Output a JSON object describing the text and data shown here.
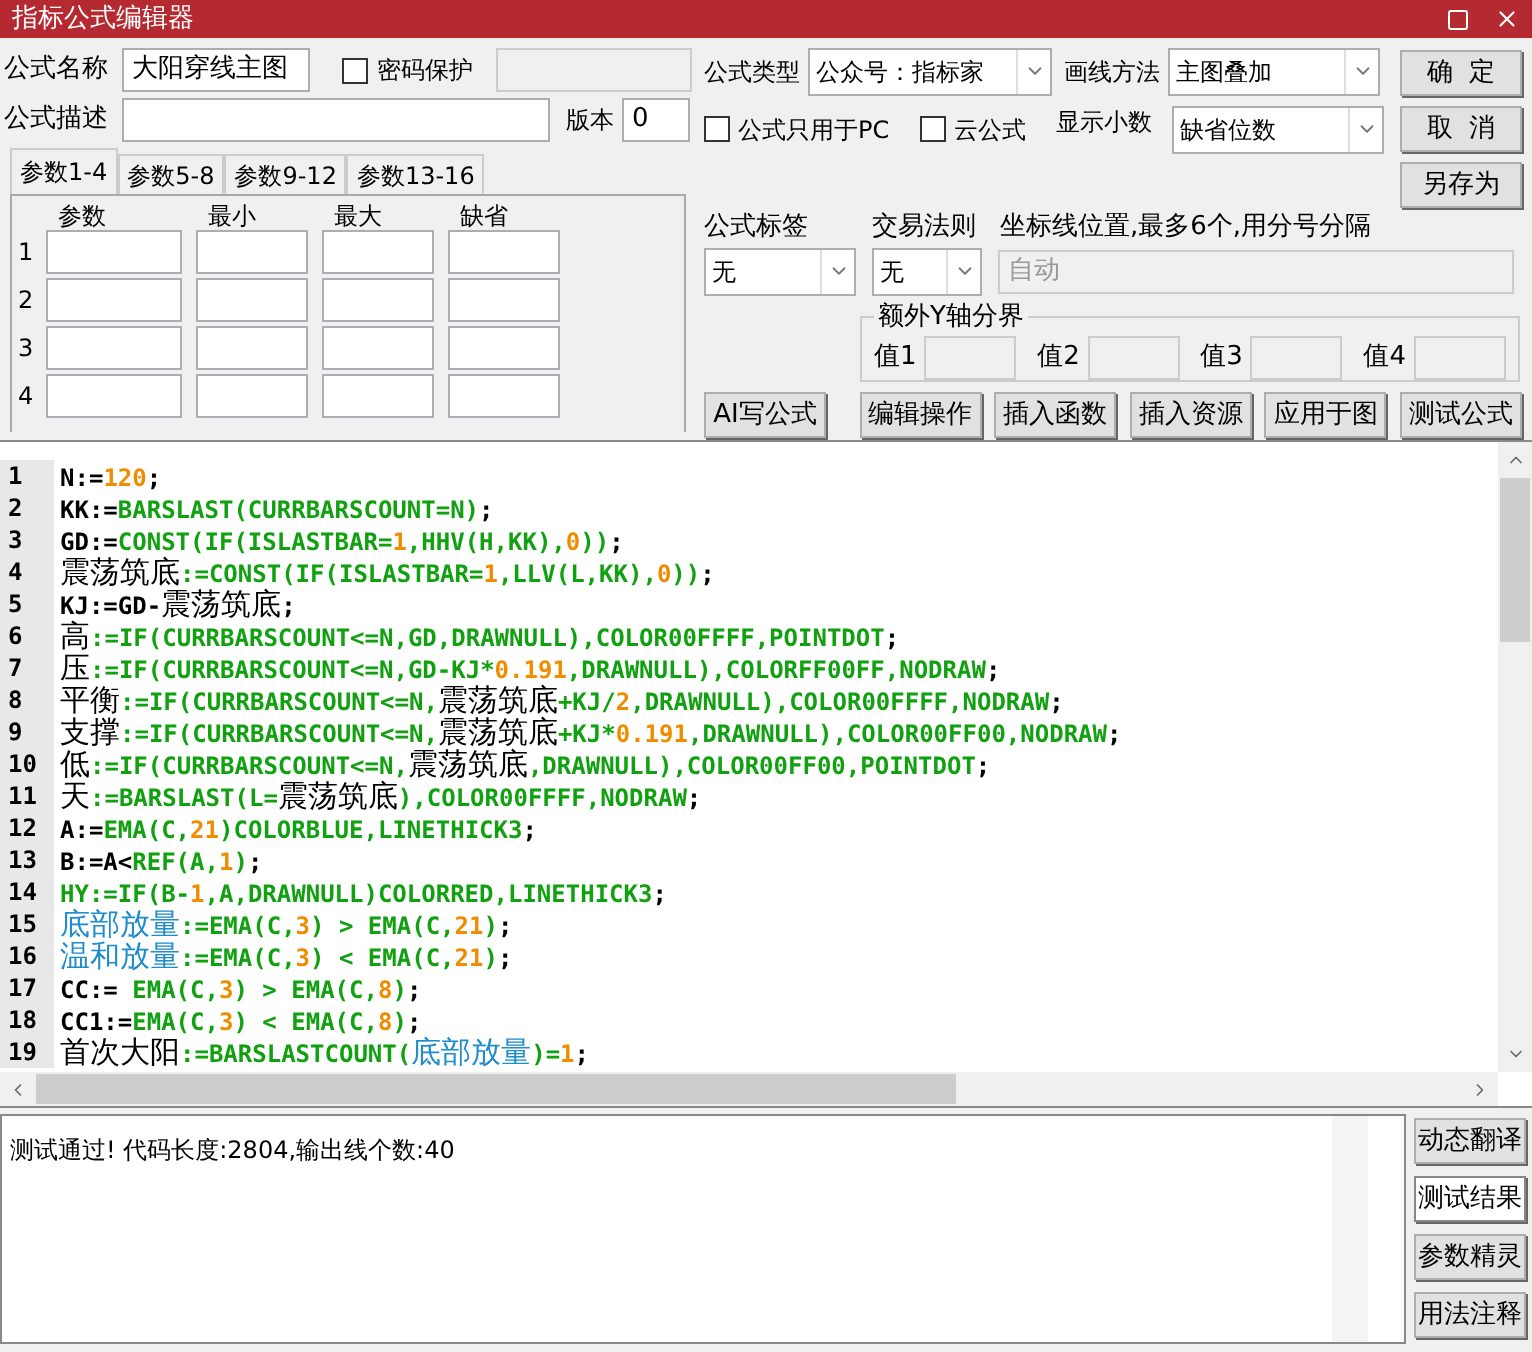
{
  "window": {
    "title": "指标公式编辑器"
  },
  "form": {
    "name_label": "公式名称",
    "name_value": "大阳穿线主图",
    "password": {
      "label": "密码保护",
      "checked": false
    },
    "desc_label": "公式描述",
    "version_label": "版本",
    "version_value": "0"
  },
  "param_tabs": [
    {
      "label": "参数1-4",
      "selected": true
    },
    {
      "label": "参数5-8",
      "selected": false
    },
    {
      "label": "参数9-12",
      "selected": false
    },
    {
      "label": "参数13-16",
      "selected": false
    }
  ],
  "param_table": {
    "columns": [
      "参数",
      "最小",
      "最大",
      "缺省"
    ],
    "rows": [
      "1",
      "2",
      "3",
      "4"
    ]
  },
  "formula_type": {
    "label": "公式类型",
    "value": "公众号：指标家"
  },
  "draw_method": {
    "label": "画线方法",
    "value": "主图叠加"
  },
  "options": [
    {
      "label": "公式只用于PC",
      "checked": false
    },
    {
      "label": "云公式",
      "checked": false
    }
  ],
  "decimals": {
    "label": "显示小数",
    "value": "缺省位数"
  },
  "tag": {
    "label": "公式标签",
    "value": "无"
  },
  "trade_rule": {
    "label": "交易法则",
    "value": "无"
  },
  "axis_lines": {
    "label": "坐标线位置,最多6个,用分号分隔",
    "placeholder": "自动"
  },
  "y_axis": {
    "title": "额外Y轴分界",
    "fields": [
      "值1",
      "值2",
      "值3",
      "值4"
    ]
  },
  "side_buttons": [
    "确  定",
    "取  消",
    "另存为"
  ],
  "tool_buttons": [
    "AI写公式",
    "编辑操作",
    "插入函数",
    "插入资源",
    "应用于图",
    "测试公式"
  ],
  "code": {
    "lines": [
      {
        "no": "1",
        "tokens": [
          {
            "t": "N:=",
            "kind": "plain"
          },
          {
            "t": "120",
            "kind": "num"
          },
          {
            "t": ";",
            "kind": "plain"
          }
        ]
      },
      {
        "no": "2",
        "tokens": [
          {
            "t": "KK:=",
            "kind": "plain"
          },
          {
            "t": "BARSLAST(CURRBARSCOUNT=N)",
            "kind": "fn"
          },
          {
            "t": ";",
            "kind": "plain"
          }
        ]
      },
      {
        "no": "3",
        "tokens": [
          {
            "t": "GD:=",
            "kind": "plain"
          },
          {
            "t": "CONST(IF(ISLASTBAR=",
            "kind": "fn"
          },
          {
            "t": "1",
            "kind": "num"
          },
          {
            "t": ",HHV(H,KK),",
            "kind": "fn"
          },
          {
            "t": "0",
            "kind": "num"
          },
          {
            "t": "))",
            "kind": "fn"
          },
          {
            "t": ";",
            "kind": "plain"
          }
        ]
      },
      {
        "no": "4",
        "tokens": [
          {
            "t": "震荡筑底",
            "kind": "cn"
          },
          {
            "t": ":=CONST(IF(ISLASTBAR=",
            "kind": "fn"
          },
          {
            "t": "1",
            "kind": "num"
          },
          {
            "t": ",LLV(L,KK),",
            "kind": "fn"
          },
          {
            "t": "0",
            "kind": "num"
          },
          {
            "t": "))",
            "kind": "fn"
          },
          {
            "t": ";",
            "kind": "plain"
          }
        ]
      },
      {
        "no": "5",
        "tokens": [
          {
            "t": "KJ:=GD-",
            "kind": "plain"
          },
          {
            "t": "震荡筑底",
            "kind": "cn"
          },
          {
            "t": ";",
            "kind": "plain"
          }
        ]
      },
      {
        "no": "6",
        "tokens": [
          {
            "t": "高",
            "kind": "cn"
          },
          {
            "t": ":=IF(CURRBARSCOUNT<=N,GD,DRAWNULL),COLOR00FFFF,POINTDOT",
            "kind": "fn"
          },
          {
            "t": ";",
            "kind": "plain"
          }
        ]
      },
      {
        "no": "7",
        "tokens": [
          {
            "t": "压",
            "kind": "cn"
          },
          {
            "t": ":=IF(CURRBARSCOUNT<=N,GD-KJ*",
            "kind": "fn"
          },
          {
            "t": "0.191",
            "kind": "num"
          },
          {
            "t": ",DRAWNULL),COLORFF00FF,NODRAW",
            "kind": "fn"
          },
          {
            "t": ";",
            "kind": "plain"
          }
        ]
      },
      {
        "no": "8",
        "tokens": [
          {
            "t": "平衡",
            "kind": "cn"
          },
          {
            "t": ":=IF(CURRBARSCOUNT<=N,",
            "kind": "fn"
          },
          {
            "t": "震荡筑底",
            "kind": "cn"
          },
          {
            "t": "+KJ/",
            "kind": "fn"
          },
          {
            "t": "2",
            "kind": "num"
          },
          {
            "t": ",DRAWNULL),COLOR00FFFF,NODRAW",
            "kind": "fn"
          },
          {
            "t": ";",
            "kind": "plain"
          }
        ]
      },
      {
        "no": "9",
        "tokens": [
          {
            "t": "支撑",
            "kind": "cn"
          },
          {
            "t": ":=IF(CURRBARSCOUNT<=N,",
            "kind": "fn"
          },
          {
            "t": "震荡筑底",
            "kind": "cn"
          },
          {
            "t": "+KJ*",
            "kind": "fn"
          },
          {
            "t": "0.191",
            "kind": "num"
          },
          {
            "t": ",DRAWNULL),COLOR00FF00,NODRAW",
            "kind": "fn"
          },
          {
            "t": ";",
            "kind": "plain"
          }
        ]
      },
      {
        "no": "10",
        "tokens": [
          {
            "t": "低",
            "kind": "cn"
          },
          {
            "t": ":=IF(CURRBARSCOUNT<=N,",
            "kind": "fn"
          },
          {
            "t": "震荡筑底",
            "kind": "cn"
          },
          {
            "t": ",DRAWNULL),COLOR00FF00,POINTDOT",
            "kind": "fn"
          },
          {
            "t": ";",
            "kind": "plain"
          }
        ]
      },
      {
        "no": "11",
        "tokens": [
          {
            "t": "天",
            "kind": "cn"
          },
          {
            "t": ":=BARSLAST(L=",
            "kind": "fn"
          },
          {
            "t": "震荡筑底",
            "kind": "cn"
          },
          {
            "t": "),COLOR00FFFF,NODRAW",
            "kind": "fn"
          },
          {
            "t": ";",
            "kind": "plain"
          }
        ]
      },
      {
        "no": "12",
        "tokens": [
          {
            "t": "A:=",
            "kind": "plain"
          },
          {
            "t": "EMA(C,",
            "kind": "fn"
          },
          {
            "t": "21",
            "kind": "num"
          },
          {
            "t": ")COLORBLUE,LINETHICK3",
            "kind": "fn"
          },
          {
            "t": ";",
            "kind": "plain"
          }
        ]
      },
      {
        "no": "13",
        "tokens": [
          {
            "t": "B:=A<",
            "kind": "plain"
          },
          {
            "t": "REF(A,",
            "kind": "fn"
          },
          {
            "t": "1",
            "kind": "num"
          },
          {
            "t": ")",
            "kind": "fn"
          },
          {
            "t": ";",
            "kind": "plain"
          }
        ]
      },
      {
        "no": "14",
        "tokens": [
          {
            "t": "HY:=IF(B-",
            "kind": "fn"
          },
          {
            "t": "1",
            "kind": "num"
          },
          {
            "t": ",A,DRAWNULL)COLORRED,LINETHICK3",
            "kind": "fn"
          },
          {
            "t": ";",
            "kind": "plain"
          }
        ]
      },
      {
        "no": "15",
        "tokens": [
          {
            "t": "底部放量",
            "kind": "var"
          },
          {
            "t": ":=EMA(C,",
            "kind": "fn"
          },
          {
            "t": "3",
            "kind": "num"
          },
          {
            "t": ") > EMA(C,",
            "kind": "fn"
          },
          {
            "t": "21",
            "kind": "num"
          },
          {
            "t": ")",
            "kind": "fn"
          },
          {
            "t": ";",
            "kind": "plain"
          }
        ]
      },
      {
        "no": "16",
        "tokens": [
          {
            "t": "温和放量",
            "kind": "var"
          },
          {
            "t": ":=EMA(C,",
            "kind": "fn"
          },
          {
            "t": "3",
            "kind": "num"
          },
          {
            "t": ") < EMA(C,",
            "kind": "fn"
          },
          {
            "t": "21",
            "kind": "num"
          },
          {
            "t": ")",
            "kind": "fn"
          },
          {
            "t": ";",
            "kind": "plain"
          }
        ]
      },
      {
        "no": "17",
        "tokens": [
          {
            "t": "CC:= ",
            "kind": "plain"
          },
          {
            "t": "EMA(C,",
            "kind": "fn"
          },
          {
            "t": "3",
            "kind": "num"
          },
          {
            "t": ") > EMA(C,",
            "kind": "fn"
          },
          {
            "t": "8",
            "kind": "num"
          },
          {
            "t": ")",
            "kind": "fn"
          },
          {
            "t": ";",
            "kind": "plain"
          }
        ]
      },
      {
        "no": "18",
        "tokens": [
          {
            "t": "CC1:=",
            "kind": "plain"
          },
          {
            "t": "EMA(C,",
            "kind": "fn"
          },
          {
            "t": "3",
            "kind": "num"
          },
          {
            "t": ") < EMA(C,",
            "kind": "fn"
          },
          {
            "t": "8",
            "kind": "num"
          },
          {
            "t": ")",
            "kind": "fn"
          },
          {
            "t": ";",
            "kind": "plain"
          }
        ]
      },
      {
        "no": "19",
        "tokens": [
          {
            "t": "首次大阳",
            "kind": "cn"
          },
          {
            "t": ":=BARSLASTCOUNT(",
            "kind": "fn"
          },
          {
            "t": "底部放量",
            "kind": "var"
          },
          {
            "t": ")=",
            "kind": "fn"
          },
          {
            "t": "1",
            "kind": "num"
          },
          {
            "t": ";",
            "kind": "plain"
          }
        ]
      }
    ]
  },
  "output": {
    "text": "测试通过! 代码长度:2804,输出线个数:40"
  },
  "output_buttons": [
    {
      "label": "动态翻译",
      "selected": false
    },
    {
      "label": "测试结果",
      "selected": true
    },
    {
      "label": "参数精灵",
      "selected": false
    },
    {
      "label": "用法注释",
      "selected": false
    }
  ]
}
